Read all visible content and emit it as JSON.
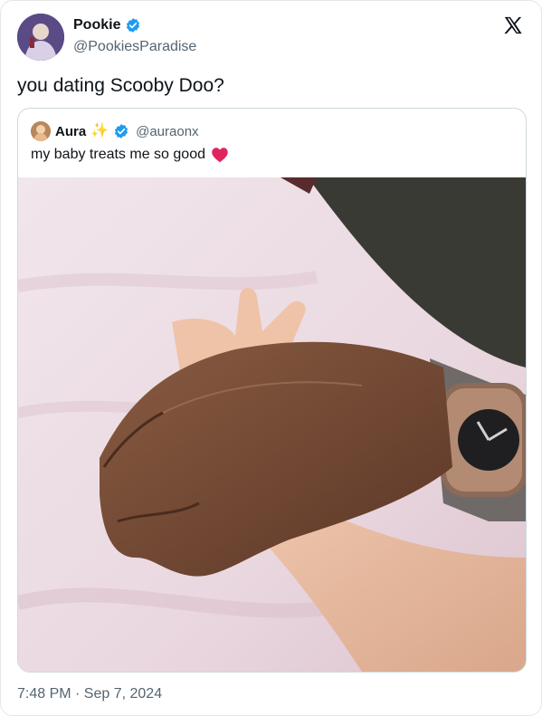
{
  "author": {
    "name": "Pookie",
    "handle": "@PookiesParadise",
    "verified": true
  },
  "tweet_text": "you dating Scooby Doo?",
  "quote": {
    "name": "Aura",
    "sparkle": "✨",
    "handle": "@auraonx",
    "verified": true,
    "text": "my baby treats me so good",
    "photo_icon": "photo-hands-icon"
  },
  "timestamp": "7:48 PM · Sep 7, 2024",
  "colors": {
    "verified": "#1d9bf0",
    "heart": "#e0245e",
    "muted": "#536471",
    "text": "#0f1419"
  }
}
